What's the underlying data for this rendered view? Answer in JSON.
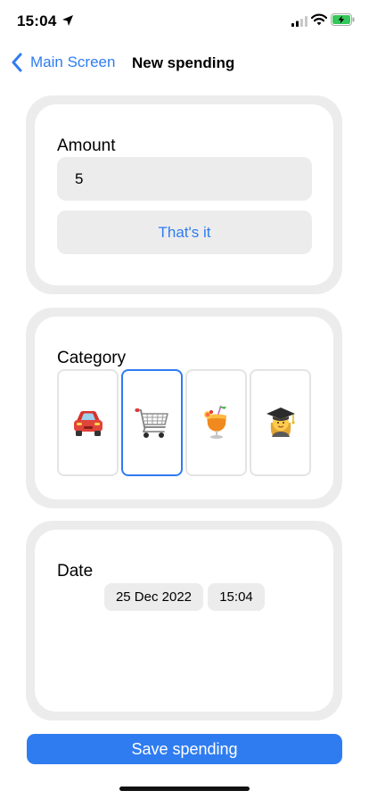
{
  "status_bar": {
    "time": "15:04",
    "icons": [
      "location-arrow-icon",
      "cellular-signal-icon",
      "wifi-icon",
      "battery-charging-icon"
    ]
  },
  "nav": {
    "back_label": "Main Screen",
    "title": "New spending",
    "accent_color": "#2f7cf0"
  },
  "amount": {
    "title": "Amount",
    "value": "5",
    "confirm_label": "That's it"
  },
  "category": {
    "title": "Category",
    "items": [
      {
        "icon": "car-icon",
        "selected": false
      },
      {
        "icon": "shopping-cart-icon",
        "selected": true
      },
      {
        "icon": "tropical-drink-icon",
        "selected": false
      },
      {
        "icon": "graduate-icon",
        "selected": false
      }
    ]
  },
  "date": {
    "title": "Date",
    "day": "25 Dec 2022",
    "time": "15:04"
  },
  "save_label": "Save spending"
}
